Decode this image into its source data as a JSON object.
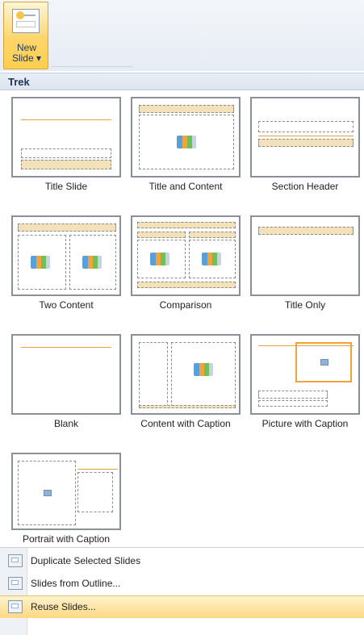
{
  "ribbon": {
    "new_slide_line1": "New",
    "new_slide_line2": "Slide ▾",
    "new_slide_icon": "new-slide-icon"
  },
  "section": {
    "title": "Trek"
  },
  "layouts": [
    {
      "label": "Title Slide"
    },
    {
      "label": "Title and Content"
    },
    {
      "label": "Section Header"
    },
    {
      "label": "Two Content"
    },
    {
      "label": "Comparison"
    },
    {
      "label": "Title Only"
    },
    {
      "label": "Blank"
    },
    {
      "label": "Content with Caption"
    },
    {
      "label": "Picture with Caption"
    },
    {
      "label": "Portrait with Caption"
    }
  ],
  "menu": {
    "items": [
      {
        "label": "Duplicate Selected Slides",
        "icon": "duplicate-slides-icon"
      },
      {
        "label": "Slides from Outline...",
        "icon": "slides-from-outline-icon"
      },
      {
        "label": "Reuse Slides...",
        "icon": "reuse-slides-icon"
      }
    ]
  },
  "colors": {
    "accent_orange": "#e8a23a",
    "highlight": "#ffd882",
    "header_bg": "#dce4ef"
  }
}
